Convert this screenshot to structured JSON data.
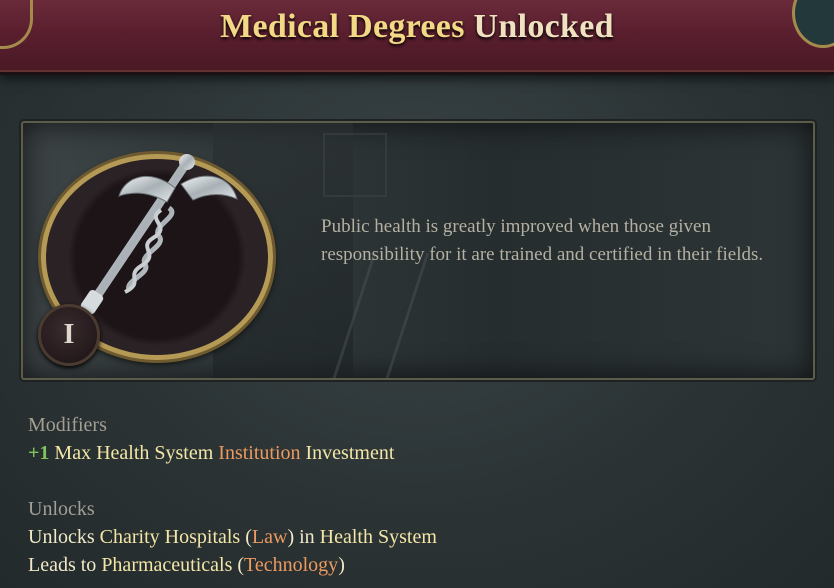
{
  "header": {
    "title_accent": "Medical Degrees",
    "title_rest": "Unlocked"
  },
  "illustration": {
    "description": "Public health is greatly improved when those given responsibility for it are trained and certified in their fields.",
    "tier": "I",
    "icon": "caduceus-icon"
  },
  "modifiers": {
    "label": "Modifiers",
    "items": [
      {
        "value": "+1",
        "t1": "Max Health System",
        "t2": "Institution",
        "t3": "Investment"
      }
    ]
  },
  "unlocks": {
    "label": "Unlocks",
    "line1": {
      "prefix": "Unlocks",
      "target": "Charity Hospitals",
      "paren_open": "(",
      "law": "Law",
      "paren_close": ")",
      "in": "in",
      "system": "Health System"
    },
    "line2": {
      "prefix": "Leads to",
      "target": "Pharmaceuticals",
      "paren_open": "(",
      "tech": "Technology",
      "paren_close": ")"
    }
  },
  "colors": {
    "header": "#5a1f2e",
    "positive": "#7fc35d",
    "link_orange": "#ec9a5f",
    "highlight_yellow": "#f3e6a6",
    "frame_gold": "#b59a55"
  }
}
